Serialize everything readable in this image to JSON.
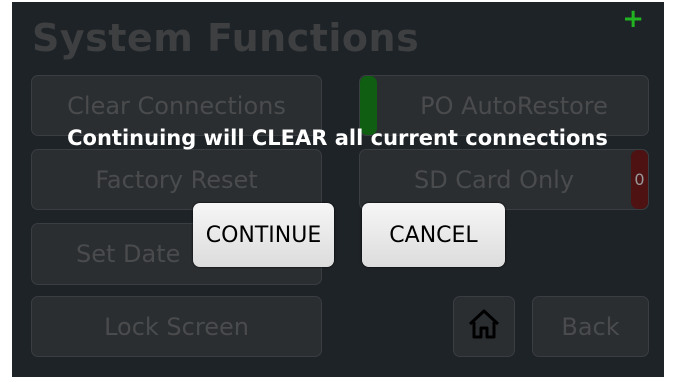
{
  "header": {
    "title": "System Functions",
    "add_symbol": "+"
  },
  "menu": {
    "clear_connections": "Clear Connections",
    "factory_reset": "Factory Reset",
    "set_date": "Set Date",
    "lock_screen": "Lock Screen",
    "po_autorestore": "PO AutoRestore",
    "sd_card_only": "SD Card Only",
    "sd_card_indicator": "0",
    "back": "Back"
  },
  "dialog": {
    "message": "Continuing will CLEAR all current connections",
    "continue_label": "CONTINUE",
    "cancel_label": "CANCEL"
  },
  "colors": {
    "background": "#1e2327",
    "plus_green": "#21b321",
    "toggle_on": "#0f5e12",
    "toggle_off": "#4e1212"
  }
}
